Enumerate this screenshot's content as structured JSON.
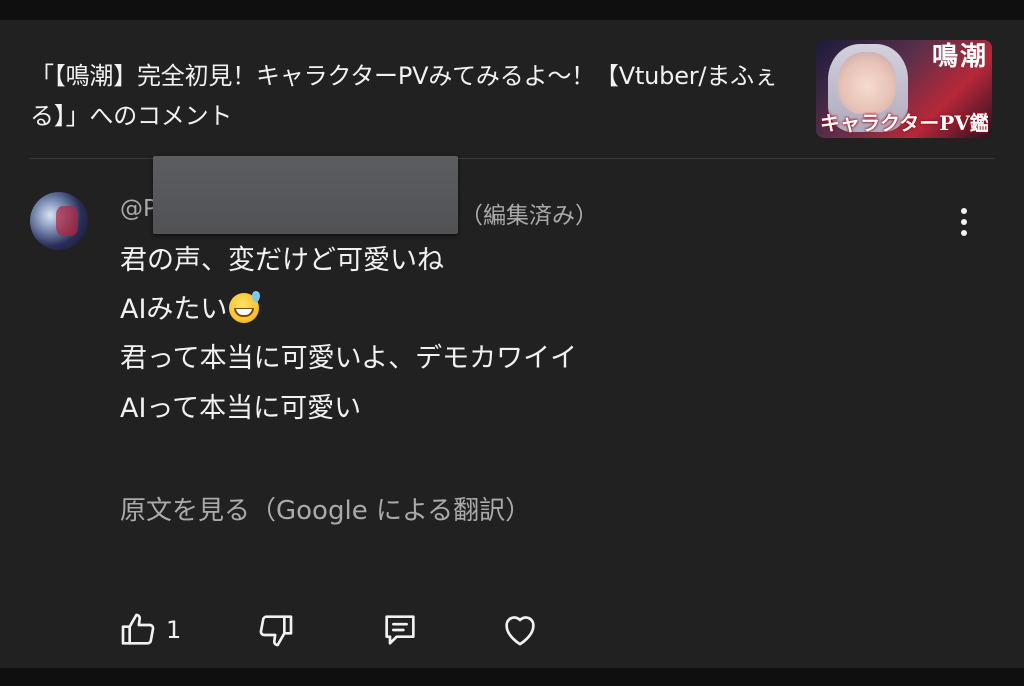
{
  "video": {
    "title": "「【鳴潮】完全初見！キャラクターPVみてみるよ〜！【Vtuber/まふぇる】」へのコメント",
    "thumbnail_text_top": "鳴潮",
    "thumbnail_text_bottom": "キャラクターPV鑑賞"
  },
  "comment": {
    "author_prefix": "@P",
    "edited_label": "（編集済み）",
    "lines": [
      "君の声、変だけど可愛いね",
      "AIみたい",
      "君って本当に可愛いよ、デモカワイイ",
      "AIって本当に可愛い"
    ],
    "emoji": "grinning-face-with-sweat",
    "translate_link": "原文を見る（Google による翻訳）"
  },
  "actions": {
    "like_count": "1"
  },
  "colors": {
    "background": "#212121",
    "text": "#f1f1f1",
    "secondary_text": "#aaaaaa"
  }
}
